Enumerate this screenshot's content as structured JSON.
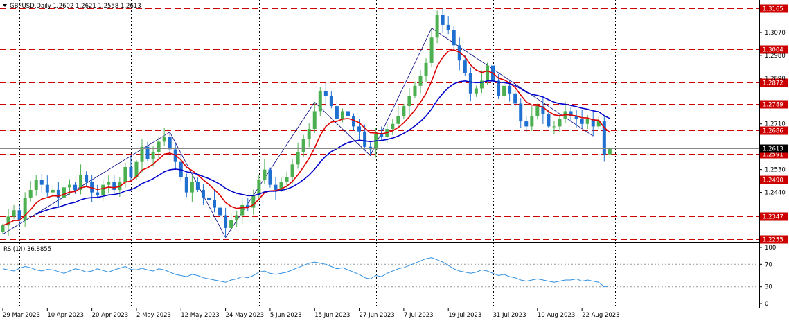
{
  "chart_data": {
    "type": "candlestick",
    "symbol_info": "GBPUSD,Daily  1.2602 1.2621 1.2558 1.2613",
    "header_arrow_icon": "triangle-down-icon",
    "ylim": [
      1.2245,
      1.319
    ],
    "price_ticks": [
      "1.3070",
      "1.2980",
      "1.2890",
      "1.2710",
      "1.2530",
      "1.2440"
    ],
    "current_price": "1.2613",
    "levels": [
      {
        "label": "1.3165",
        "value": 1.3165
      },
      {
        "label": "1.3004",
        "value": 1.3004
      },
      {
        "label": "1.2872",
        "value": 1.2872
      },
      {
        "label": "1.2789",
        "value": 1.2789
      },
      {
        "label": "1.2686",
        "value": 1.2686
      },
      {
        "label": "1.2591",
        "value": 1.2591
      },
      {
        "label": "1.2490",
        "value": 1.249
      },
      {
        "label": "1.2347",
        "value": 1.2347
      },
      {
        "label": "1.2255",
        "value": 1.2255
      }
    ],
    "date_labels": [
      {
        "label": "29 Mar 2023",
        "index": 0
      },
      {
        "label": "10 Apr 2023",
        "index": 8
      },
      {
        "label": "20 Apr 2023",
        "index": 16
      },
      {
        "label": "2 May 2023",
        "index": 24
      },
      {
        "label": "12 May 2023",
        "index": 32
      },
      {
        "label": "24 May 2023",
        "index": 40
      },
      {
        "label": "5 Jun 2023",
        "index": 48
      },
      {
        "label": "15 Jun 2023",
        "index": 56
      },
      {
        "label": "27 Jun 2023",
        "index": 64
      },
      {
        "label": "7 Jul 2023",
        "index": 72
      },
      {
        "label": "19 Jul 2023",
        "index": 80
      },
      {
        "label": "31 Jul 2023",
        "index": 88
      },
      {
        "label": "10 Aug 2023",
        "index": 96
      },
      {
        "label": "22 Aug 2023",
        "index": 104
      }
    ],
    "vlines_index": [
      3,
      23,
      46,
      67,
      88,
      110
    ],
    "closes": [
      1.231,
      1.2345,
      1.237,
      1.233,
      1.242,
      1.245,
      1.249,
      1.247,
      1.244,
      1.245,
      1.242,
      1.246,
      1.247,
      1.245,
      1.251,
      1.248,
      1.244,
      1.243,
      1.247,
      1.248,
      1.245,
      1.248,
      1.254,
      1.25,
      1.256,
      1.262,
      1.257,
      1.26,
      1.264,
      1.266,
      1.261,
      1.256,
      1.25,
      1.244,
      1.248,
      1.245,
      1.242,
      1.241,
      1.238,
      1.235,
      1.23,
      1.233,
      1.235,
      1.239,
      1.238,
      1.243,
      1.249,
      1.253,
      1.247,
      1.245,
      1.248,
      1.25,
      1.255,
      1.26,
      1.265,
      1.269,
      1.276,
      1.284,
      1.282,
      1.278,
      1.273,
      1.276,
      1.274,
      1.27,
      1.268,
      1.262,
      1.261,
      1.267,
      1.266,
      1.269,
      1.271,
      1.274,
      1.278,
      1.282,
      1.286,
      1.29,
      1.295,
      1.305,
      1.314,
      1.31,
      1.308,
      1.302,
      1.296,
      1.291,
      1.283,
      1.285,
      1.288,
      1.294,
      1.288,
      1.282,
      1.286,
      1.283,
      1.279,
      1.272,
      1.27,
      1.274,
      1.278,
      1.275,
      1.27,
      1.27,
      1.273,
      1.276,
      1.274,
      1.273,
      1.271,
      1.273,
      1.27,
      1.272,
      1.259,
      1.2613
    ],
    "rsi": {
      "label": "RSI(14) 36.8855",
      "ylim": [
        0,
        100
      ],
      "ticks": [
        "100",
        "70",
        "30",
        "0"
      ],
      "guide_levels": [
        70,
        30
      ],
      "values": [
        62,
        60,
        58,
        63,
        66,
        64,
        60,
        58,
        61,
        60,
        57,
        54,
        58,
        62,
        60,
        56,
        58,
        62,
        59,
        56,
        60,
        63,
        66,
        61,
        60,
        63,
        60,
        58,
        62,
        60,
        56,
        52,
        50,
        48,
        52,
        50,
        46,
        44,
        42,
        40,
        38,
        42,
        44,
        48,
        46,
        50,
        56,
        58,
        54,
        52,
        54,
        56,
        60,
        64,
        68,
        72,
        74,
        72,
        70,
        66,
        62,
        64,
        60,
        56,
        52,
        46,
        44,
        50,
        48,
        54,
        58,
        62,
        64,
        68,
        72,
        76,
        80,
        82,
        78,
        74,
        68,
        62,
        58,
        56,
        54,
        56,
        60,
        58,
        54,
        50,
        52,
        48,
        46,
        42,
        40,
        42,
        44,
        42,
        40,
        38,
        40,
        42,
        42,
        44,
        40,
        42,
        40,
        38,
        30,
        32
      ]
    },
    "colors": {
      "bull": "#4caf50",
      "bear": "#1e6fd0",
      "ma_fast": "#dd0000",
      "ma_slow": "#0000cc",
      "rsi_line": "#2f8fe0",
      "level_line": "#cc0000",
      "level_tag": "#cc0000",
      "grid": "#000000",
      "trendline": "#000080"
    }
  }
}
